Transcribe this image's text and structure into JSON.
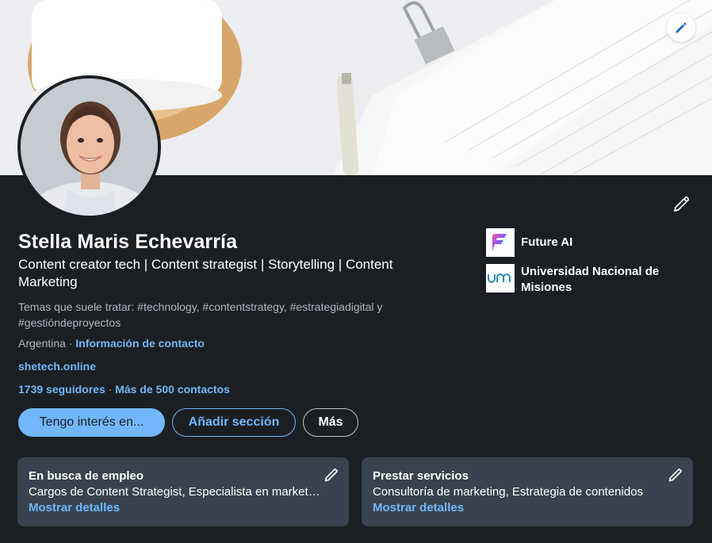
{
  "profile": {
    "name": "Stella Maris Echevarría",
    "headline": "Content creator tech | Content strategist | Storytelling | Content Marketing",
    "topics": "Temas que suele tratar: #technology, #contentstrategy, #estrategiadigital y #gestióndeproyectos",
    "location": "Argentina",
    "separator": " · ",
    "contact_info_link": "Información de contacto",
    "website": "shetech.online",
    "followers": "1739 seguidores",
    "connections": "Más de 500 contactos"
  },
  "actions": {
    "open_to": "Tengo interés en...",
    "add_section": "Añadir sección",
    "more": "Más"
  },
  "organizations": [
    {
      "name": "Future AI",
      "logo": "future-ai-logo"
    },
    {
      "name": "Universidad Nacional de Misiones",
      "logo": "unam-logo"
    }
  ],
  "panels": [
    {
      "title": "En busca de empleo",
      "description": "Cargos de Content Strategist, Especialista en marketing de contenidos",
      "link": "Mostrar detalles"
    },
    {
      "title": "Prestar servicios",
      "description": "Consultoría de marketing, Estrategia de contenidos",
      "link": "Mostrar detalles"
    }
  ],
  "icons": {
    "banner_edit": "pencil-icon",
    "intro_edit": "pencil-icon",
    "panel_edit": "pencil-icon"
  },
  "colors": {
    "background": "#1b1f23",
    "accent": "#71b7fb",
    "panel": "#38434f",
    "muted_text": "#b0b6bc"
  }
}
